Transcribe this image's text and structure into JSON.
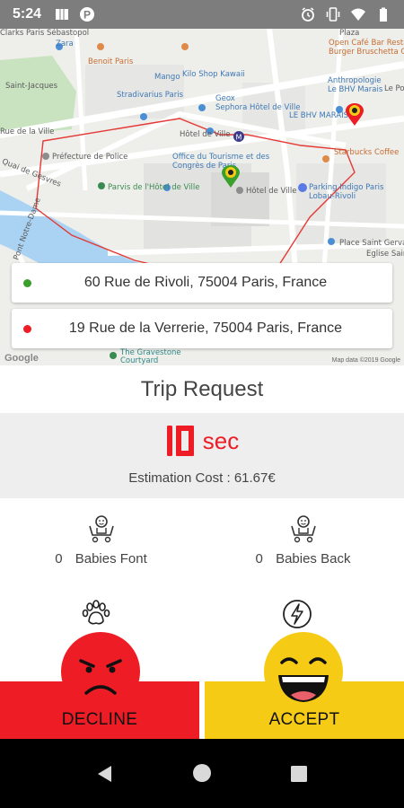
{
  "status_bar": {
    "time": "5:24",
    "left_icons": [
      "notification-icon",
      "parking-icon"
    ],
    "right_icons": [
      "alarm-icon",
      "vibrate-icon",
      "wifi-icon",
      "battery-icon"
    ]
  },
  "map": {
    "labels": {
      "zara": "Zara",
      "benoit": "Benoit Paris",
      "mango": "Mango",
      "kilo": "Kilo Shop Kawaii",
      "stradivarius": "Stradivarius Paris",
      "geox": "Geox",
      "sephora": "Sephora Hôtel de Ville",
      "bhv": "LE BHV MARAIS",
      "anthropologie": "Anthropologie Le BHV Marais",
      "opencafe": "Open Café Bar Restaurant",
      "burger": "Burger Bruschetta Chef",
      "prefecture": "Préfecture de Police",
      "office": "Office du Tourisme et des Congrès de Paris",
      "hotelville1": "Hôtel de Ville",
      "hotelville2": "Hôtel de Ville",
      "parvis": "Parvis de l'Hôtel de Ville",
      "starbucks": "Starbucks Coffee",
      "parking": "Parking Indigo Paris Lobau-Rivoli",
      "saint": "Place Saint Gervais",
      "stjacques": "Saint-Jacques",
      "gravestone": "The Gravestone Courtyard",
      "eglise": "Eglise Saint",
      "quai": "Quai de Gesvres",
      "pont": "Pont Notre-Dame",
      "plaza": "Plaza",
      "lepo": "Le Po",
      "rue": "Rue de la Ville",
      "clarks": "Clarks Paris Sébastopol"
    },
    "google_logo": "Google",
    "attribution": "Map data ©2019 Google"
  },
  "pickup": {
    "address": "60 Rue de Rivoli, 75004 Paris, France",
    "dot_color": "#3aa02b"
  },
  "dropoff": {
    "address": "19 Rue de la Verrerie, 75004 Paris, France",
    "dot_color": "#ee1c25"
  },
  "trip": {
    "title": "Trip Request",
    "countdown": 10,
    "unit": "sec",
    "estimation_label": "Estimation Cost : 61.67€"
  },
  "babies": {
    "front": {
      "count": "0",
      "label": "Babies Font"
    },
    "back": {
      "count": "0",
      "label": "Babies Back"
    }
  },
  "actions": {
    "decline_label": "DECLINE",
    "accept_label": "ACCEPT",
    "decline_color": "#ee1c25",
    "accept_color": "#f5cb15"
  },
  "nav": {
    "icons": [
      "back-icon",
      "home-icon",
      "recents-icon"
    ]
  }
}
